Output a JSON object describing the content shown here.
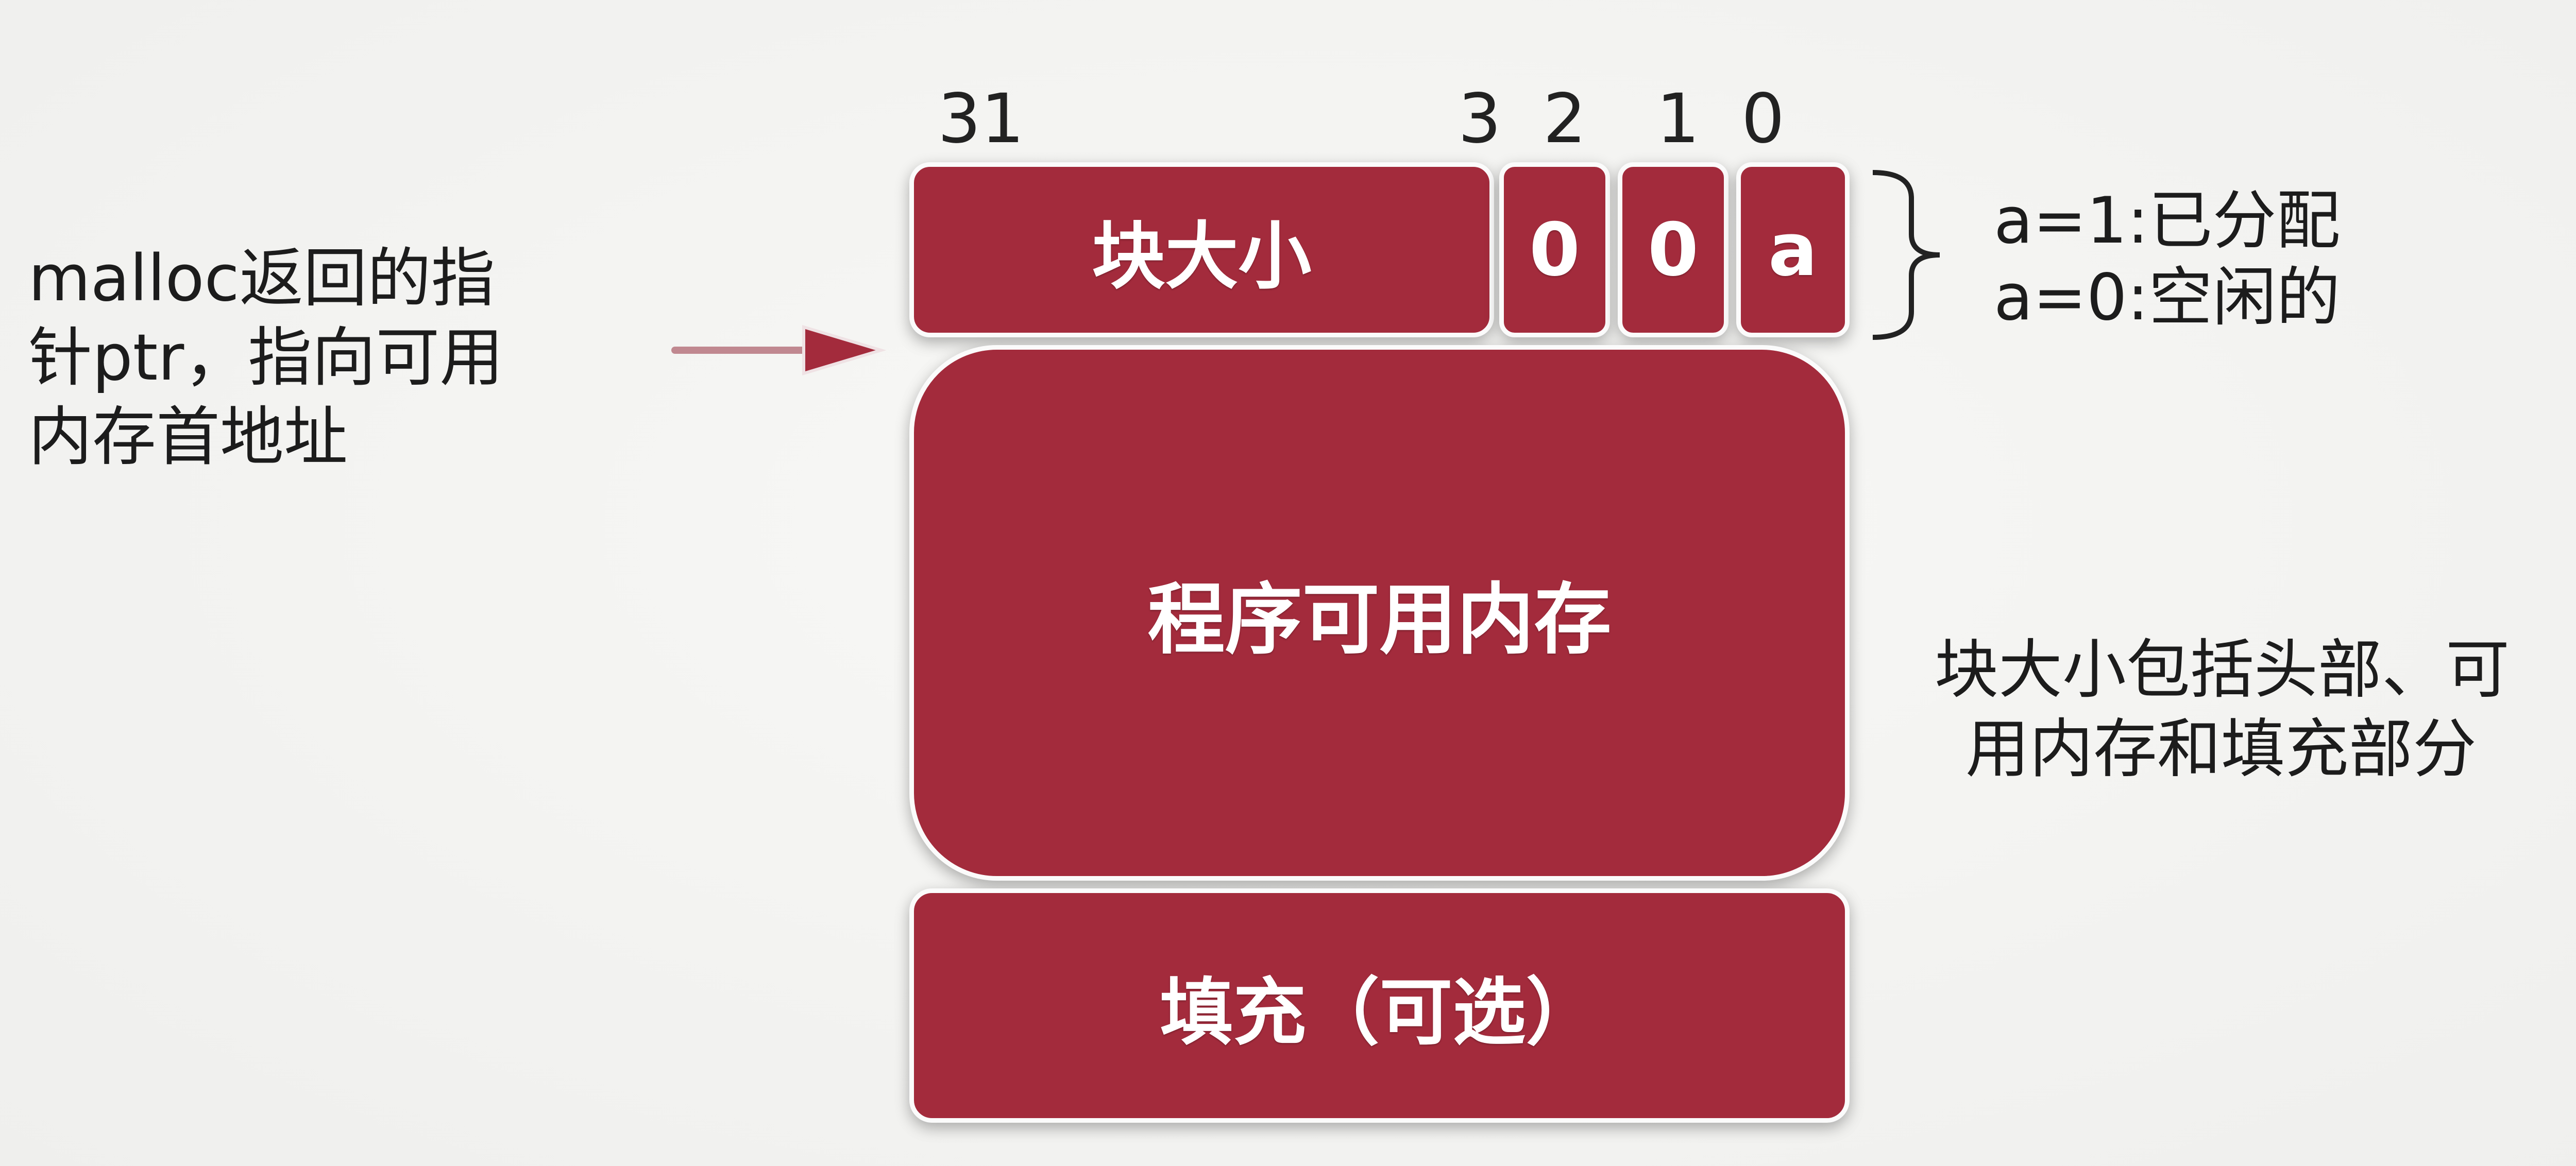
{
  "bit_positions": {
    "b31": "31",
    "b3": "3",
    "b2": "2",
    "b1": "1",
    "b0": "0"
  },
  "header": {
    "size_label": "块大小",
    "bit2": "0",
    "bit1": "0",
    "alloc_bit": "a"
  },
  "payload_label": "程序可用内存",
  "padding_label": "填充（可选）",
  "pointer_note": [
    "malloc返回的指",
    "针ptr，指向可用",
    "内存首地址"
  ],
  "alloc_legend": [
    "a=1:已分配",
    "a=0:空闲的"
  ],
  "size_note": [
    "块大小包括头部、可",
    "用内存和填充部分"
  ],
  "colors": {
    "block_fill": "#a32b3c",
    "arrow_fill": "#a32b3c",
    "text": "#1c1c1c"
  }
}
